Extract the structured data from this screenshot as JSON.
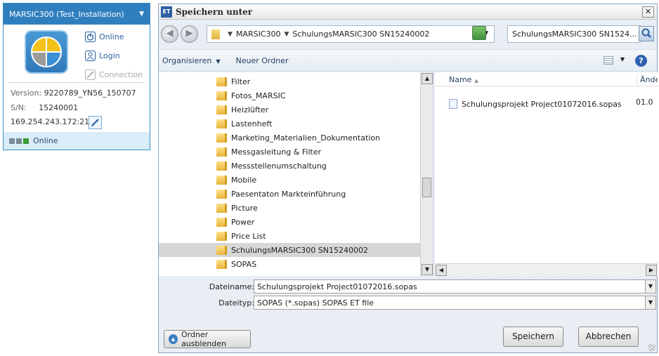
{
  "device": {
    "title": "MARSIC300 (Test_Installation)",
    "actions": {
      "online": "Online",
      "login": "Login",
      "connection": "Connection"
    },
    "version_key": "Version:",
    "version_value": "9220789_YN56_150707",
    "sn_key": "S/N:",
    "sn_value": "15240001",
    "address": "169.254.243.172:2112",
    "status": "Online"
  },
  "dialog": {
    "title": "Speichern unter",
    "app_icon": "ET",
    "close": "✕",
    "breadcrumb": [
      "MARSIC300",
      "SchulungsMARSIC300 SN15240002"
    ],
    "search_value": "SchulungsMARSIC300 SN1524...",
    "toolbar": {
      "organize": "Organisieren",
      "new_folder": "Neuer Ordner"
    },
    "folders": [
      "Filter",
      "Fotos_MARSIC",
      "Heizlüfter",
      "Lastenheft",
      "Marketing_Materialien_Dokumentation",
      "Messgasleitung & Filter",
      "Messstellenumschaltung",
      "Mobile",
      "Paesentaton Markteinführung",
      "Picture",
      "Power",
      "Price List",
      "SchulungsMARSIC300 SN15240002",
      "SOPAS"
    ],
    "selected_folder_index": 12,
    "columns": {
      "name": "Name",
      "date": "Ände"
    },
    "files": [
      {
        "name": "Schulungsprojekt Project01072016.sopas",
        "date": "01.0"
      }
    ],
    "filename_label": "Dateiname:",
    "filename_value": "Schulungsprojekt Project01072016.sopas",
    "filetype_label": "Dateityp:",
    "filetype_value": "SOPAS (*.sopas) SOPAS ET file",
    "hide_folders": "Ordner ausblenden",
    "save": "Speichern",
    "cancel": "Abbrechen"
  }
}
